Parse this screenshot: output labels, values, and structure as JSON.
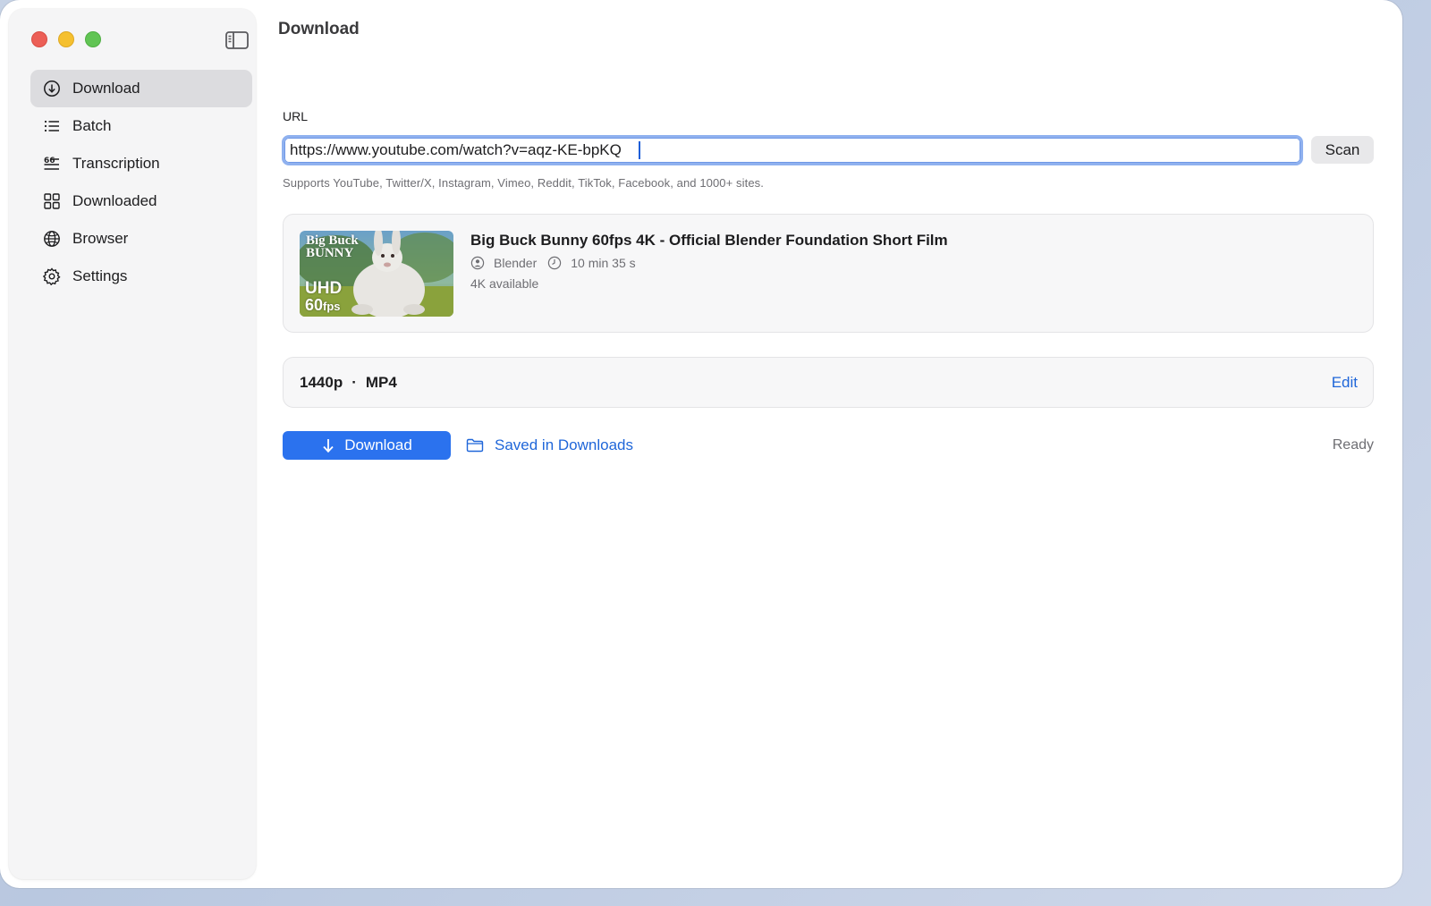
{
  "window": {
    "title": "Download"
  },
  "sidebar": {
    "items": [
      {
        "label": "Download",
        "icon": "download-circle-icon",
        "active": true
      },
      {
        "label": "Batch",
        "icon": "list-icon"
      },
      {
        "label": "Transcription",
        "icon": "transcription-icon"
      },
      {
        "label": "Downloaded",
        "icon": "grid-icon"
      },
      {
        "label": "Browser",
        "icon": "globe-icon"
      },
      {
        "label": "Settings",
        "icon": "gear-icon"
      }
    ]
  },
  "url": {
    "label": "URL",
    "value": "https://www.youtube.com/watch?v=aqz-KE-bpKQ",
    "scan_label": "Scan",
    "hint": "Supports YouTube, Twitter/X, Instagram, Vimeo, Reddit, TikTok, Facebook, and 1000+ sites."
  },
  "video": {
    "title": "Big Buck Bunny 60fps 4K - Official Blender Foundation Short Film",
    "channel": "Blender",
    "duration": "10 min 35 s",
    "availability": "4K available",
    "thumbnail": {
      "line1": "Big Buck",
      "line2": "BUNNY",
      "badge1": "UHD",
      "badge2": "60",
      "badge3": "fps"
    }
  },
  "format": {
    "resolution": "1440p",
    "separator": "·",
    "container": "MP4",
    "edit_label": "Edit"
  },
  "actions": {
    "download_label": "Download",
    "saved_label": "Saved in Downloads",
    "status": "Ready"
  },
  "colors": {
    "accent": "#2b72ee",
    "link": "#1f66d9",
    "close": "#ec5f57",
    "minimize": "#f5c02f",
    "maximize": "#61c454"
  }
}
